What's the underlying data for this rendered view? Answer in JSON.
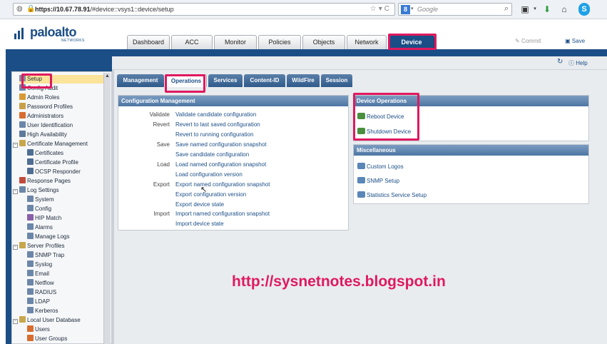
{
  "browser": {
    "url_host": "https://10.67.78.91",
    "url_path": "/#device::vsys1::device/setup",
    "search_engine": "8",
    "search_placeholder": "Google"
  },
  "app": {
    "logo_name": "paloalto",
    "logo_sub": "NETWORKS",
    "tabs": [
      "Dashboard",
      "ACC",
      "Monitor",
      "Policies",
      "Objects",
      "Network",
      "Device"
    ],
    "active_tab": "Device",
    "commit_label": "Commit",
    "save_label": "Save",
    "help_label": "Help"
  },
  "sidebar": {
    "items": [
      {
        "label": "Setup",
        "level": 1,
        "selected": true
      },
      {
        "label": "Config Audit",
        "level": 1
      },
      {
        "label": "Admin Roles",
        "level": 1
      },
      {
        "label": "Password Profiles",
        "level": 1
      },
      {
        "label": "Administrators",
        "level": 1
      },
      {
        "label": "User Identification",
        "level": 1
      },
      {
        "label": "High Availability",
        "level": 1
      },
      {
        "label": "Certificate Management",
        "level": 0
      },
      {
        "label": "Certificates",
        "level": 2
      },
      {
        "label": "Certificate Profile",
        "level": 2
      },
      {
        "label": "OCSP Responder",
        "level": 2
      },
      {
        "label": "Response Pages",
        "level": 1
      },
      {
        "label": "Log Settings",
        "level": 0
      },
      {
        "label": "System",
        "level": 2
      },
      {
        "label": "Config",
        "level": 2
      },
      {
        "label": "HIP Match",
        "level": 2
      },
      {
        "label": "Alarms",
        "level": 2
      },
      {
        "label": "Manage Logs",
        "level": 2
      },
      {
        "label": "Server Profiles",
        "level": 0
      },
      {
        "label": "SNMP Trap",
        "level": 2
      },
      {
        "label": "Syslog",
        "level": 2
      },
      {
        "label": "Email",
        "level": 2
      },
      {
        "label": "Netflow",
        "level": 2
      },
      {
        "label": "RADIUS",
        "level": 2
      },
      {
        "label": "LDAP",
        "level": 2
      },
      {
        "label": "Kerberos",
        "level": 2
      },
      {
        "label": "Local User Database",
        "level": 0
      },
      {
        "label": "Users",
        "level": 2
      },
      {
        "label": "User Groups",
        "level": 2
      }
    ]
  },
  "subtabs": [
    "Management",
    "Operations",
    "Services",
    "Content-ID",
    "WildFire",
    "Session"
  ],
  "active_subtab": "Operations",
  "config_management": {
    "title": "Configuration Management",
    "rows": [
      {
        "label": "Validate",
        "link": "Validate candidate configuration"
      },
      {
        "label": "Revert",
        "link": "Revert to last saved configuration"
      },
      {
        "label": "",
        "link": "Revert to running configuration"
      },
      {
        "label": "Save",
        "link": "Save named configuration snapshot"
      },
      {
        "label": "",
        "link": "Save candidate configuration"
      },
      {
        "label": "Load",
        "link": "Load named configuration snapshot"
      },
      {
        "label": "",
        "link": "Load configuration version"
      },
      {
        "label": "Export",
        "link": "Export named configuration snapshot"
      },
      {
        "label": "",
        "link": "Export configuration version"
      },
      {
        "label": "",
        "link": "Export device state"
      },
      {
        "label": "Import",
        "link": "Import named configuration snapshot"
      },
      {
        "label": "",
        "link": "Import device state"
      }
    ]
  },
  "device_operations": {
    "title": "Device Operations",
    "items": [
      "Reboot Device",
      "Shutdown Device"
    ]
  },
  "miscellaneous": {
    "title": "Miscellaneous",
    "items": [
      "Custom Logos",
      "SNMP Setup",
      "Statistics Service Setup"
    ]
  },
  "watermark": "http://sysnetnotes.blogspot.in",
  "colors": {
    "brand": "#1b4e86",
    "highlight": "#e0195f",
    "selected": "#fbe49a"
  }
}
